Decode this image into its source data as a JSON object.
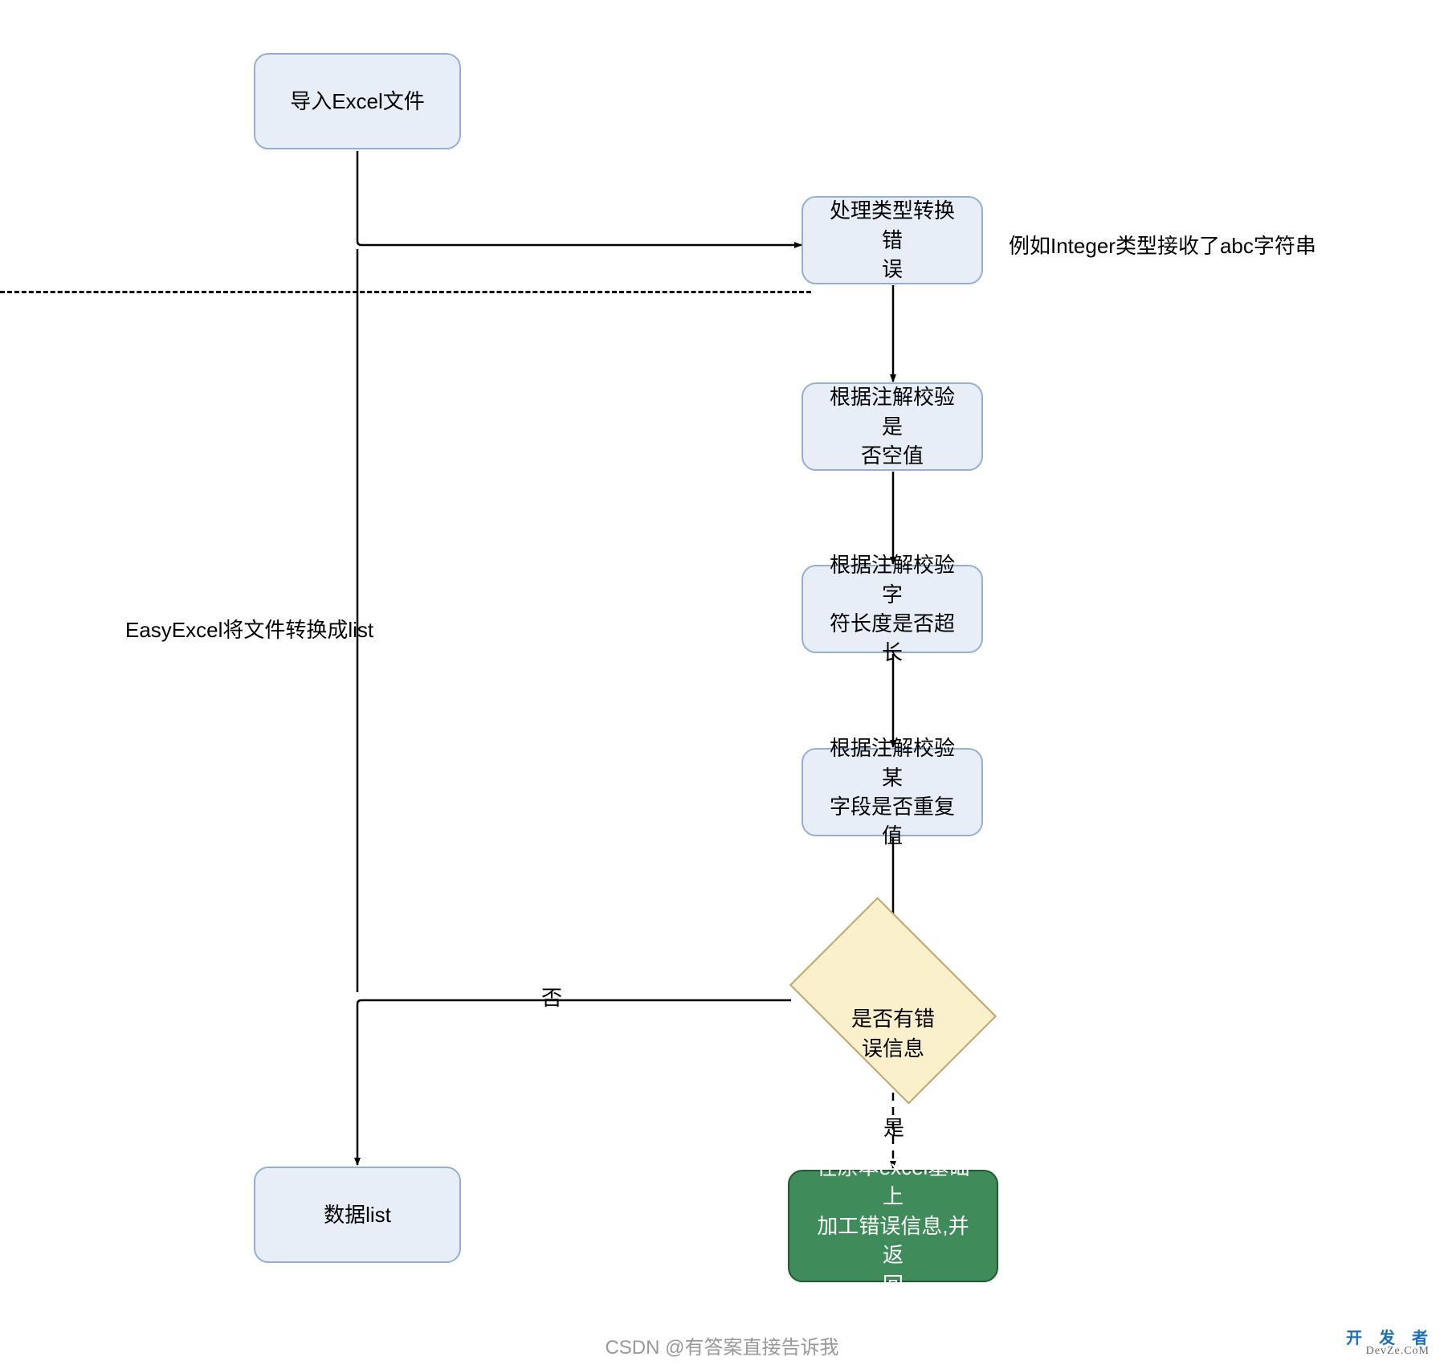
{
  "nodes": {
    "import": "导入Excel文件",
    "type_error": "处理类型转换错\n误",
    "null_check": "根据注解校验是\n否空值",
    "length_check": "根据注解校验字\n符长度是否超长",
    "dup_check": "根据注解校验某\n字段是否重复值",
    "data_list": "数据list",
    "result": "在原本excel基础上\n加工错误信息,并返\n回"
  },
  "decision": {
    "has_error": "是否有错\n误信息"
  },
  "labels": {
    "convert": "EasyExcel将文件转换成list",
    "example": "例如Integer类型接收了abc字符串",
    "no": "否",
    "yes": "是"
  },
  "footer": {
    "watermark": "CSDN @有答案直接告诉我",
    "logo": "开 发 者",
    "logo_sub": "DevZe.CoM"
  }
}
